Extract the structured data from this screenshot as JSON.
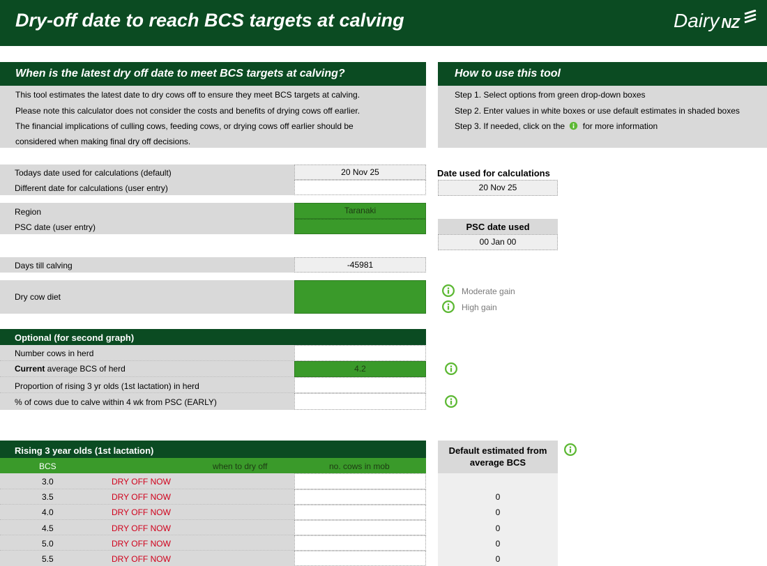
{
  "banner": {
    "title": "Dry-off date to reach BCS targets at calving",
    "logo_main": "Dairy",
    "logo_nz": "NZ"
  },
  "left_panel": {
    "heading": "When is the latest dry off date to meet BCS targets at calving?",
    "lines": [
      "This tool estimates the latest date to dry cows off to ensure they meet BCS targets at calving.",
      "Please note this calculator does not consider the costs and benefits of drying cows off earlier.",
      "The financial implications of culling cows, feeding cows, or drying cows off earlier should be",
      "considered when making final dry off decisions."
    ]
  },
  "right_panel": {
    "heading": "How to use this tool",
    "step1": "Step 1. Select options from green drop-down boxes",
    "step2": "Step 2. Enter values in white boxes or use default estimates in shaded boxes",
    "step3_before": "Step 3. If needed, click on the",
    "step3_after": "for more information"
  },
  "dates": {
    "todays_label": "Todays date used for calculations (default)",
    "todays_value": "20 Nov 25",
    "different_label": "Different date for calculations (user entry)",
    "different_value": "",
    "used_header": "Date used for calculations",
    "used_value": "20 Nov 25"
  },
  "region": {
    "label": "Region",
    "value": "Taranaki",
    "psc_label": "PSC date (user entry)",
    "psc_value": "",
    "psc_used_header": "PSC date used",
    "psc_used_value": "00 Jan 00"
  },
  "days": {
    "label": "Days till calving",
    "value": "-45981"
  },
  "diet": {
    "label": "Dry cow diet",
    "value": "",
    "option_moderate": "Moderate gain",
    "option_high": "High gain"
  },
  "optional": {
    "heading": "Optional (for second graph)",
    "cows_label": "Number cows in herd",
    "cows_value": "",
    "current_bold": "Current",
    "current_rest": " average BCS of herd",
    "current_value": "4.2",
    "prop_label": "Proportion of rising 3 yr olds (1st lactation) in herd",
    "prop_value": "",
    "early_label": "% of cows due to calve within 4 wk from PSC (EARLY)",
    "early_value": ""
  },
  "rising": {
    "heading": "Rising 3 year olds (1st lactation)",
    "col_bcs": "BCS",
    "col_when": "when to dry off",
    "col_cows": "no. cows in mob",
    "default_header": "Default estimated from average BCS",
    "rows": [
      {
        "bcs": "3.0",
        "when": "DRY OFF NOW",
        "cows": "",
        "def": ""
      },
      {
        "bcs": "3.5",
        "when": "DRY OFF NOW",
        "cows": "",
        "def": "0"
      },
      {
        "bcs": "4.0",
        "when": "DRY OFF NOW",
        "cows": "",
        "def": "0"
      },
      {
        "bcs": "4.5",
        "when": "DRY OFF NOW",
        "cows": "",
        "def": "0"
      },
      {
        "bcs": "5.0",
        "when": "DRY OFF NOW",
        "cows": "",
        "def": "0"
      },
      {
        "bcs": "5.5",
        "when": "DRY OFF NOW",
        "cows": "",
        "def": "0"
      }
    ]
  },
  "colors": {
    "dark_green": "#0b4b22",
    "input_green": "#3a9a2a",
    "icon_green": "#5cb833",
    "alert_red": "#d0001b"
  }
}
